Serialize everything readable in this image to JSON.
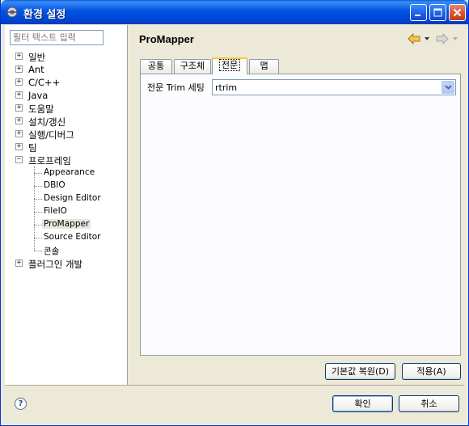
{
  "window": {
    "title": "환경 설정"
  },
  "filter": {
    "placeholder": "필터 텍스트 입력"
  },
  "tree": {
    "items": [
      {
        "label": "일반"
      },
      {
        "label": "Ant"
      },
      {
        "label": "C/C++"
      },
      {
        "label": "Java"
      },
      {
        "label": "도움말"
      },
      {
        "label": "설치/갱신"
      },
      {
        "label": "실행/디버그"
      },
      {
        "label": "팀"
      },
      {
        "label": "프로프레임"
      },
      {
        "label": "Appearance"
      },
      {
        "label": "DBIO"
      },
      {
        "label": "Design Editor"
      },
      {
        "label": "FileIO"
      },
      {
        "label": "ProMapper"
      },
      {
        "label": "Source Editor"
      },
      {
        "label": "콘솔"
      },
      {
        "label": "플러그인 개발"
      }
    ]
  },
  "page": {
    "title": "ProMapper"
  },
  "tabs": [
    {
      "label": "공통"
    },
    {
      "label": "구조체"
    },
    {
      "label": "전문"
    },
    {
      "label": "맵"
    }
  ],
  "form": {
    "trim_label": "전문 Trim 세팅",
    "trim_value": "rtrim"
  },
  "buttons": {
    "restore": "기본값 복원(D)",
    "apply": "적용(A)",
    "ok": "확인",
    "cancel": "취소"
  },
  "icons": {
    "help": "?"
  }
}
